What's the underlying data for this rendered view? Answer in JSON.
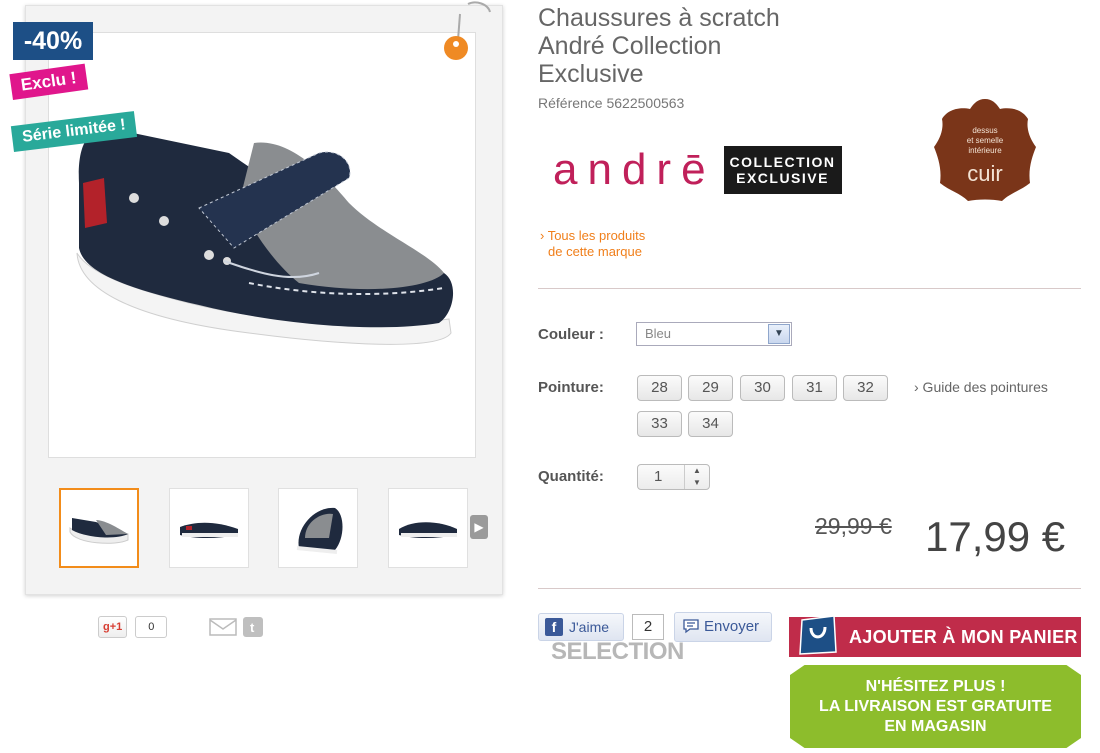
{
  "gallery": {
    "badges": {
      "discount": "-40%",
      "exclu": "Exclu !",
      "serie": "Série limitée !"
    },
    "thumbnail_count": 4
  },
  "share": {
    "gplus_label": "+1",
    "gplus_count": "0"
  },
  "product": {
    "title_lines": [
      "Chaussures à scratch",
      "André Collection",
      "Exclusive"
    ],
    "reference": "Référence 5622500563",
    "brand": {
      "name": "andrē",
      "box_line1": "COLLECTION",
      "box_line2": "EXCLUSIVE",
      "link_line1": "› Tous les produits",
      "link_line2": "de cette marque"
    },
    "cuir_badge": {
      "line1": "dessus",
      "line2": "et semelle",
      "line3": "intérieure",
      "word": "cuir"
    }
  },
  "options": {
    "color_label": "Couleur :",
    "color_value": "Bleu",
    "size_label": "Pointure:",
    "sizes": [
      "28",
      "29",
      "30",
      "31",
      "32",
      "33",
      "34"
    ],
    "size_guide": "› Guide des pointures",
    "qty_label": "Quantité:",
    "qty_value": "1"
  },
  "pricing": {
    "old_price": "29,99 €",
    "new_price": "17,99 €"
  },
  "social": {
    "fb_like": "J'aime",
    "fb_count": "2",
    "send": "Envoyer",
    "selection": "SELECTION"
  },
  "cart": {
    "add_label": "AJOUTER À MON PANIER ›",
    "promo_line1": "N'HÉSITEZ PLUS !",
    "promo_line2": "LA LIVRAISON EST GRATUITE",
    "promo_line3": "EN MAGASIN"
  },
  "colors": {
    "accent_orange": "#f07f1b",
    "cart_red": "#c02c4a",
    "promo_green": "#8dbd2c",
    "brand_pink": "#c0205a",
    "discount_blue": "#1d4f86"
  }
}
